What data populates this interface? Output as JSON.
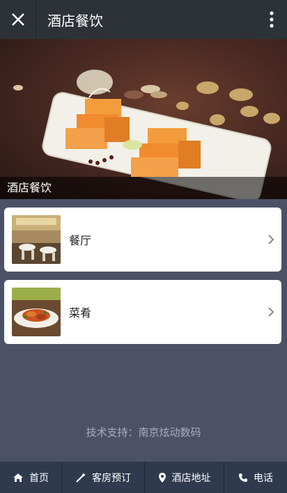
{
  "header": {
    "close_icon": "close-icon",
    "title": "酒店餐饮",
    "more_icon": "more-vertical-icon"
  },
  "banner": {
    "caption": "酒店餐饮"
  },
  "cards": [
    {
      "label": "餐厅",
      "thumb": "restaurant-photo",
      "chevron": "chevron-right-icon"
    },
    {
      "label": "菜肴",
      "thumb": "dish-photo",
      "chevron": "chevron-right-icon"
    }
  ],
  "footer": {
    "credit": "技术支持：南京炫动数码"
  },
  "nav": [
    {
      "label": "首页",
      "icon": "home-icon"
    },
    {
      "label": "客房预订",
      "icon": "magic-wand-icon"
    },
    {
      "label": "酒店地址",
      "icon": "map-pin-icon"
    },
    {
      "label": "电话",
      "icon": "phone-icon"
    }
  ]
}
